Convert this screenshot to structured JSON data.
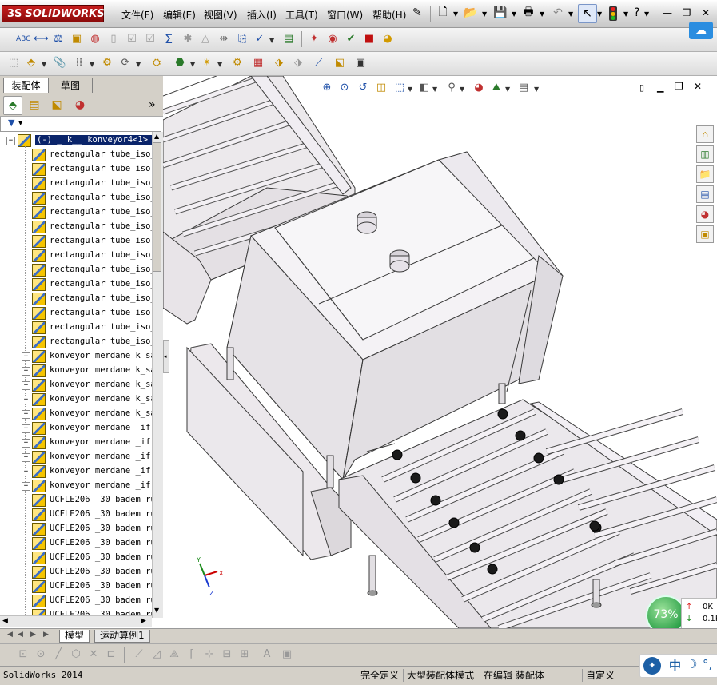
{
  "app": {
    "brand": "SOLIDWORKS",
    "brand_prefix": "3S",
    "menu": [
      "文件(F)",
      "编辑(E)",
      "视图(V)",
      "插入(I)",
      "工具(T)",
      "窗口(W)",
      "帮助(H)"
    ],
    "window_controls": [
      "minimize",
      "restore",
      "close"
    ],
    "help_mark": "?"
  },
  "panel": {
    "tabs": [
      "装配体",
      "草图"
    ],
    "expand_glyph": "»",
    "root_label": "(-)  _ k__ konveyor4<1> (",
    "items": [
      {
        "label": "rectangular tube_iso_",
        "expandable": false
      },
      {
        "label": "rectangular tube_iso_",
        "expandable": false
      },
      {
        "label": "rectangular tube_iso_",
        "expandable": false
      },
      {
        "label": "rectangular tube_iso_",
        "expandable": false
      },
      {
        "label": "rectangular tube_iso_",
        "expandable": false
      },
      {
        "label": "rectangular tube_iso_",
        "expandable": false
      },
      {
        "label": "rectangular tube_iso_",
        "expandable": false
      },
      {
        "label": "rectangular tube_iso_",
        "expandable": false
      },
      {
        "label": "rectangular tube_iso_",
        "expandable": false
      },
      {
        "label": "rectangular tube_iso_",
        "expandable": false
      },
      {
        "label": "rectangular tube_iso_",
        "expandable": false
      },
      {
        "label": "rectangular tube_iso_",
        "expandable": false
      },
      {
        "label": "rectangular tube_iso_",
        "expandable": false
      },
      {
        "label": "rectangular tube_iso_",
        "expandable": false
      },
      {
        "label": "konveyor merdane k_sa",
        "expandable": true
      },
      {
        "label": "konveyor merdane k_sa",
        "expandable": true
      },
      {
        "label": "konveyor merdane k_sa",
        "expandable": true
      },
      {
        "label": "konveyor merdane k_sa",
        "expandable": true
      },
      {
        "label": "konveyor merdane k_sa",
        "expandable": true
      },
      {
        "label": "konveyor merdane _if",
        "expandable": true
      },
      {
        "label": "konveyor merdane _if",
        "expandable": true
      },
      {
        "label": "konveyor merdane _if",
        "expandable": true
      },
      {
        "label": "konveyor merdane _if",
        "expandable": true
      },
      {
        "label": "konveyor merdane _if",
        "expandable": true
      },
      {
        "label": "UCFLE206 _30 badem ru",
        "expandable": false
      },
      {
        "label": "UCFLE206 _30 badem ru",
        "expandable": false
      },
      {
        "label": "UCFLE206 _30 badem ru",
        "expandable": false
      },
      {
        "label": "UCFLE206 _30 badem ru",
        "expandable": false
      },
      {
        "label": "UCFLE206 _30 badem ru",
        "expandable": false
      },
      {
        "label": "UCFLE206 _30 badem ru",
        "expandable": false
      },
      {
        "label": "UCFLE206 _30 badem ru",
        "expandable": false
      },
      {
        "label": "UCFLE206 _30 badem ru",
        "expandable": false
      },
      {
        "label": "UCFLE206 _30 badem ru",
        "expandable": false
      }
    ]
  },
  "bottom_tabs": [
    "模型",
    "运动算例1"
  ],
  "status": {
    "app_version": "SolidWorks 2014",
    "fields": [
      "完全定义",
      "大型装配体模式",
      "在编辑 装配体",
      "自定义"
    ]
  },
  "performance": {
    "percent": "73%",
    "up": "0K",
    "down": "0.1K"
  },
  "ime": {
    "text": "中"
  },
  "colors": {
    "brand_red": "#b01515",
    "viewport_bg": "#ffffff",
    "model_body": "#ece9ec",
    "model_edge": "#3a3a3a",
    "perf_green": "#2ea24a",
    "tree_selected": "#0a246a"
  }
}
